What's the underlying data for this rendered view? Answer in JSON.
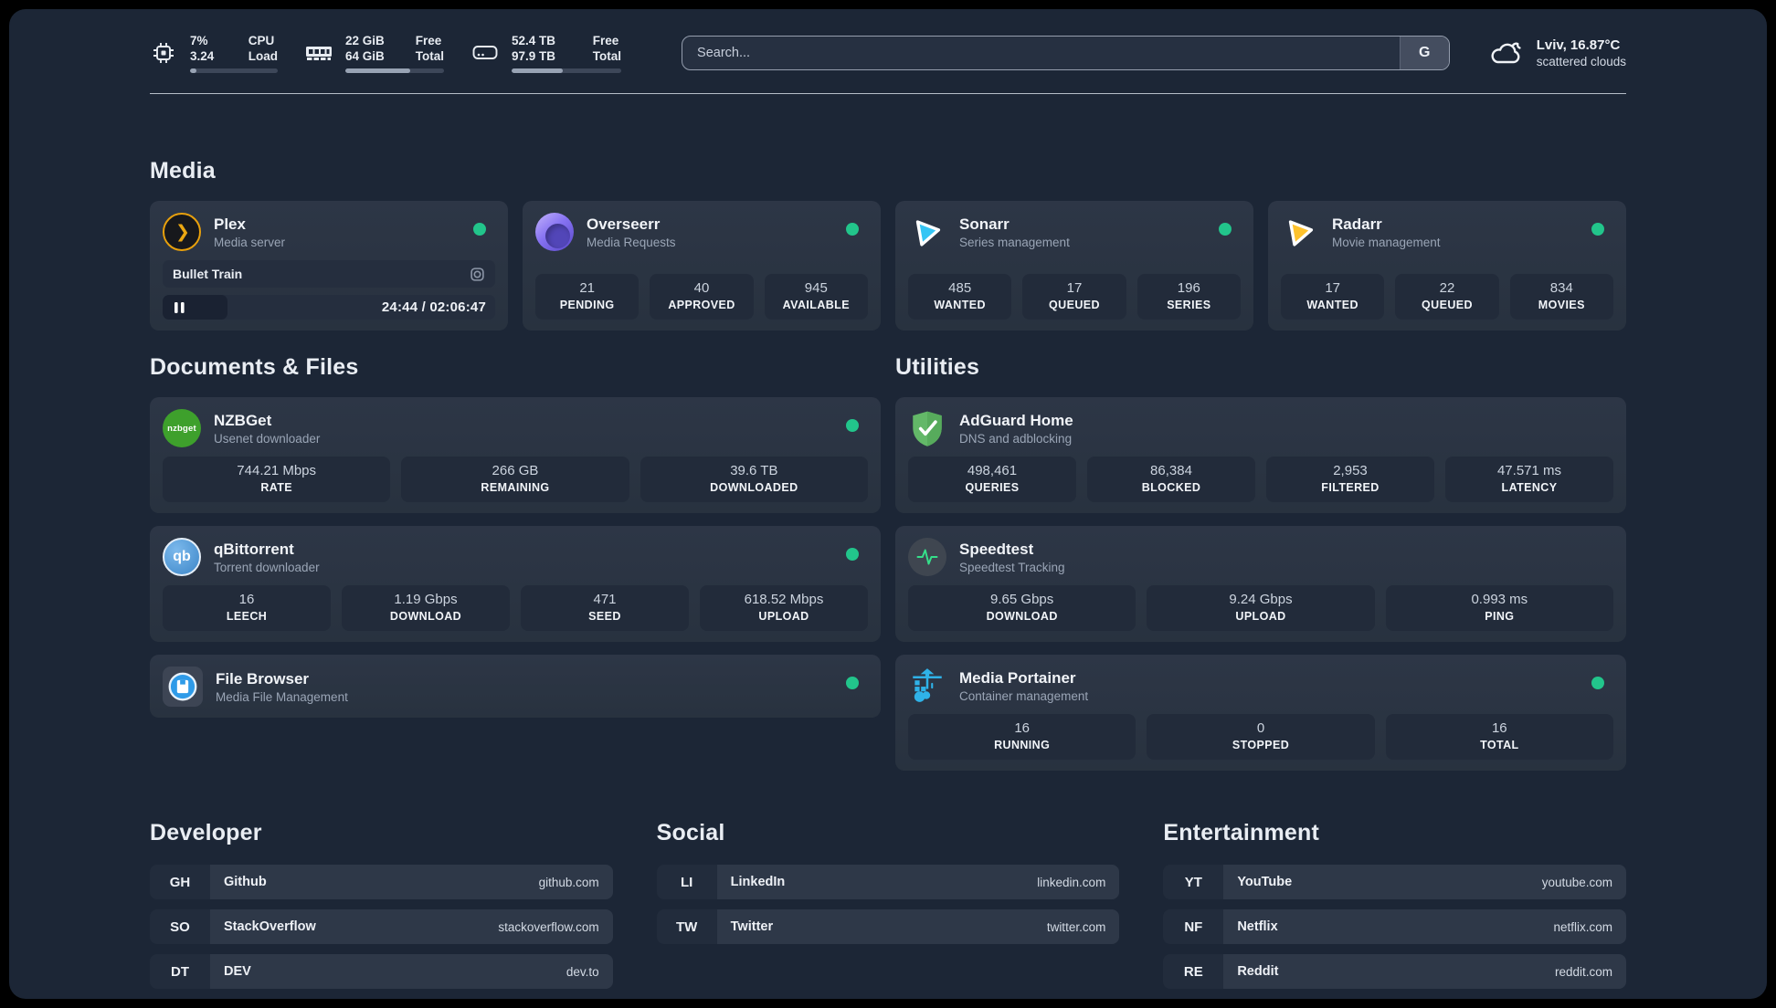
{
  "colors": {
    "status_ok": "#22c58b",
    "background": "#1c2636",
    "card": "#2b3444",
    "plex_amber": "#e8a00c",
    "sonarr_cyan": "#35c5f4",
    "radarr_yellow": "#fec22b",
    "adguard_green": "#5cb85c",
    "portainer_blue": "#2fb2e8"
  },
  "header": {
    "system": [
      {
        "name": "cpu",
        "values": [
          "7%",
          "3.24"
        ],
        "labels": [
          "CPU",
          "Load"
        ],
        "progress_pct": 7
      },
      {
        "name": "memory",
        "values": [
          "22 GiB",
          "64 GiB"
        ],
        "labels": [
          "Free",
          "Total"
        ],
        "progress_pct": 66
      },
      {
        "name": "storage",
        "values": [
          "52.4 TB",
          "97.9 TB"
        ],
        "labels": [
          "Free",
          "Total"
        ],
        "progress_pct": 47
      }
    ],
    "search": {
      "placeholder": "Search...",
      "engine_button": "G"
    },
    "weather": {
      "location_temp": "Lviv, 16.87°C",
      "condition": "scattered clouds"
    }
  },
  "sections": {
    "media": {
      "title": "Media",
      "apps": [
        {
          "name": "Plex",
          "subtitle": "Media server",
          "icon": "plex-icon",
          "status": "online",
          "player": {
            "title": "Bullet Train",
            "time_display": "24:44 / 02:06:47",
            "progress_pct": 19.5,
            "state": "paused"
          }
        },
        {
          "name": "Overseerr",
          "subtitle": "Media Requests",
          "icon": "overseerr-icon",
          "status": "online",
          "stats": [
            {
              "value": "21",
              "label": "PENDING"
            },
            {
              "value": "40",
              "label": "APPROVED"
            },
            {
              "value": "945",
              "label": "AVAILABLE"
            }
          ]
        },
        {
          "name": "Sonarr",
          "subtitle": "Series management",
          "icon": "sonarr-icon",
          "status": "online",
          "stats": [
            {
              "value": "485",
              "label": "WANTED"
            },
            {
              "value": "17",
              "label": "QUEUED"
            },
            {
              "value": "196",
              "label": "SERIES"
            }
          ]
        },
        {
          "name": "Radarr",
          "subtitle": "Movie management",
          "icon": "radarr-icon",
          "status": "online",
          "stats": [
            {
              "value": "17",
              "label": "WANTED"
            },
            {
              "value": "22",
              "label": "QUEUED"
            },
            {
              "value": "834",
              "label": "MOVIES"
            }
          ]
        }
      ]
    },
    "documents": {
      "title": "Documents & Files",
      "apps": [
        {
          "name": "NZBGet",
          "subtitle": "Usenet downloader",
          "icon": "nzbget-icon",
          "status": "online",
          "stats": [
            {
              "value": "744.21 Mbps",
              "label": "RATE"
            },
            {
              "value": "266 GB",
              "label": "REMAINING"
            },
            {
              "value": "39.6 TB",
              "label": "DOWNLOADED"
            }
          ]
        },
        {
          "name": "qBittorrent",
          "subtitle": "Torrent downloader",
          "icon": "qbittorrent-icon",
          "status": "online",
          "stats": [
            {
              "value": "16",
              "label": "LEECH"
            },
            {
              "value": "1.19 Gbps",
              "label": "DOWNLOAD"
            },
            {
              "value": "471",
              "label": "SEED"
            },
            {
              "value": "618.52 Mbps",
              "label": "UPLOAD"
            }
          ]
        },
        {
          "name": "File Browser",
          "subtitle": "Media File Management",
          "icon": "filebrowser-icon",
          "status": "online"
        }
      ]
    },
    "utilities": {
      "title": "Utilities",
      "apps": [
        {
          "name": "AdGuard Home",
          "subtitle": "DNS and adblocking",
          "icon": "adguard-icon",
          "stats": [
            {
              "value": "498,461",
              "label": "QUERIES"
            },
            {
              "value": "86,384",
              "label": "BLOCKED"
            },
            {
              "value": "2,953",
              "label": "FILTERED"
            },
            {
              "value": "47.571 ms",
              "label": "LATENCY"
            }
          ]
        },
        {
          "name": "Speedtest",
          "subtitle": "Speedtest Tracking",
          "icon": "speedtest-icon",
          "stats": [
            {
              "value": "9.65 Gbps",
              "label": "DOWNLOAD"
            },
            {
              "value": "9.24 Gbps",
              "label": "UPLOAD"
            },
            {
              "value": "0.993 ms",
              "label": "PING"
            }
          ]
        },
        {
          "name": "Media Portainer",
          "subtitle": "Container management",
          "icon": "portainer-icon",
          "status": "online",
          "stats": [
            {
              "value": "16",
              "label": "RUNNING"
            },
            {
              "value": "0",
              "label": "STOPPED"
            },
            {
              "value": "16",
              "label": "TOTAL"
            }
          ]
        }
      ]
    },
    "links": [
      {
        "title": "Developer",
        "items": [
          {
            "abbr": "GH",
            "name": "Github",
            "url": "github.com"
          },
          {
            "abbr": "SO",
            "name": "StackOverflow",
            "url": "stackoverflow.com"
          },
          {
            "abbr": "DT",
            "name": "DEV",
            "url": "dev.to"
          }
        ]
      },
      {
        "title": "Social",
        "items": [
          {
            "abbr": "LI",
            "name": "LinkedIn",
            "url": "linkedin.com"
          },
          {
            "abbr": "TW",
            "name": "Twitter",
            "url": "twitter.com"
          }
        ]
      },
      {
        "title": "Entertainment",
        "items": [
          {
            "abbr": "YT",
            "name": "YouTube",
            "url": "youtube.com"
          },
          {
            "abbr": "NF",
            "name": "Netflix",
            "url": "netflix.com"
          },
          {
            "abbr": "RE",
            "name": "Reddit",
            "url": "reddit.com"
          }
        ]
      }
    ]
  }
}
